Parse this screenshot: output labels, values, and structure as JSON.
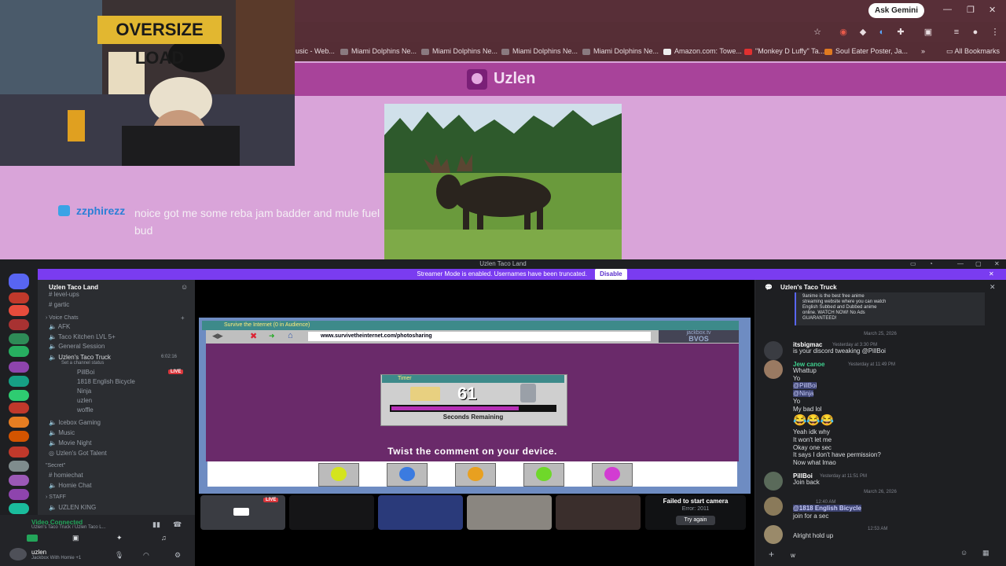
{
  "browser": {
    "ask_gemini": "Ask Gemini",
    "bookmarks": [
      "usic - Web...",
      "Miami Dolphins Ne...",
      "Miami Dolphins Ne...",
      "Miami Dolphins Ne...",
      "Miami Dolphins Ne...",
      "Amazon.com: Towe...",
      "\"Monkey D Luffy\" Ta...",
      "Soul Eater Poster, Ja..."
    ],
    "all_bookmarks": "All Bookmarks",
    "site_title": "Uzlen"
  },
  "stream": {
    "webcam_sign": "OVERSIZE LOAD",
    "chat_user": "zzphirezz",
    "chat_message": "noice got me some reba jam badder and mule fuel bud"
  },
  "discord": {
    "window_title": "Uzlen Taco Land",
    "banner_text": "Streamer Mode is enabled. Usernames have been truncated.",
    "banner_button": "Disable",
    "server_name": "Uzlen Taco Land",
    "channels": {
      "level_ups": "level-ups",
      "gartic": "gartic",
      "voice_category": "Voice Chats",
      "afk": "AFK",
      "taco_kitchen": "Taco Kitchen LVL 5+",
      "general": "General Session",
      "taco_truck": "Uzlen's Taco Truck",
      "taco_truck_time": "6:02:16",
      "set_status": "Set a channel status",
      "voice_users": [
        "PillBoi",
        "1818 English Bicycle",
        "Ninja",
        "uzlen",
        "woffle"
      ],
      "live_badge": "LIVE",
      "icebox": "Icebox Gaming",
      "music": "Music",
      "movie_night": "Movie Night",
      "got_talent": "Uzlen's Got Talent",
      "secret_category": "\"Secret\"",
      "homiechat": "homiechat",
      "homie_chat": "Homie Chat",
      "staff_category": "STAFF",
      "uzlen_king": "UZLEN KING"
    },
    "voice_status": {
      "connected": "Video Connected",
      "location": "Uzlen's Taco Truck / Uzlen Taco L...",
      "user": "uzlen",
      "user_activity": "Jackbox With Homie +1"
    },
    "game": {
      "window_title": "Survive the Internet (0 in Audience)",
      "url": "www.survivetheinternet.com/photosharing",
      "brand": "jackbox.tv",
      "room_code": "BVOS",
      "timer_label": "Timer",
      "timer_value": "61",
      "timer_progress": 0.78,
      "timer_caption": "Seconds Remaining",
      "instruction": "Twist the comment on your device.",
      "choice_colors": [
        "#d4e41e",
        "#3b7be0",
        "#e8a020",
        "#6fd82a",
        "#d23cd2"
      ]
    },
    "camera": {
      "live_badge": "LIVE",
      "failed_title": "Failed to start camera",
      "failed_error": "Error: 2011",
      "try_again": "Try again"
    },
    "chat": {
      "channel_title": "Uzlen's Taco Truck",
      "embed_text": [
        "9anime is the best free anime",
        "streaming website where you can watch",
        "English Subbed and Dubbed anime",
        "online. WATCH NOW! No Ads",
        "GUARANTEED!"
      ],
      "date1": "March 25, 2026",
      "date2": "March 26, 2026",
      "messages": [
        {
          "name": "itsbigmac",
          "time": "Yesterday at 3:30 PM",
          "lines": [
            "is your discord tweaking @PillBoi"
          ]
        },
        {
          "name": "Jew canoe",
          "time": "Yesterday at 11:49 PM",
          "lines": [
            "Whattup",
            "Yo",
            "@PillBoi",
            "@Ninja",
            "Yo",
            "My bad lol"
          ]
        },
        {
          "name": "",
          "time": "",
          "lines": [
            "Yeah idk why",
            "It won't let me",
            "Okay one sec",
            "It says I don't have permission?",
            "Now what lmao"
          ]
        },
        {
          "name": "PillBoi",
          "time": "Yesterday at 11:51 PM",
          "lines": [
            "Join back"
          ]
        },
        {
          "name": "@1818 English Bicycle",
          "time": "12:40 AM",
          "lines": [
            "join for a sec"
          ]
        },
        {
          "name": "",
          "time": "12:53 AM",
          "lines": [
            "Alright hold up"
          ]
        }
      ],
      "input_value": "w"
    }
  }
}
